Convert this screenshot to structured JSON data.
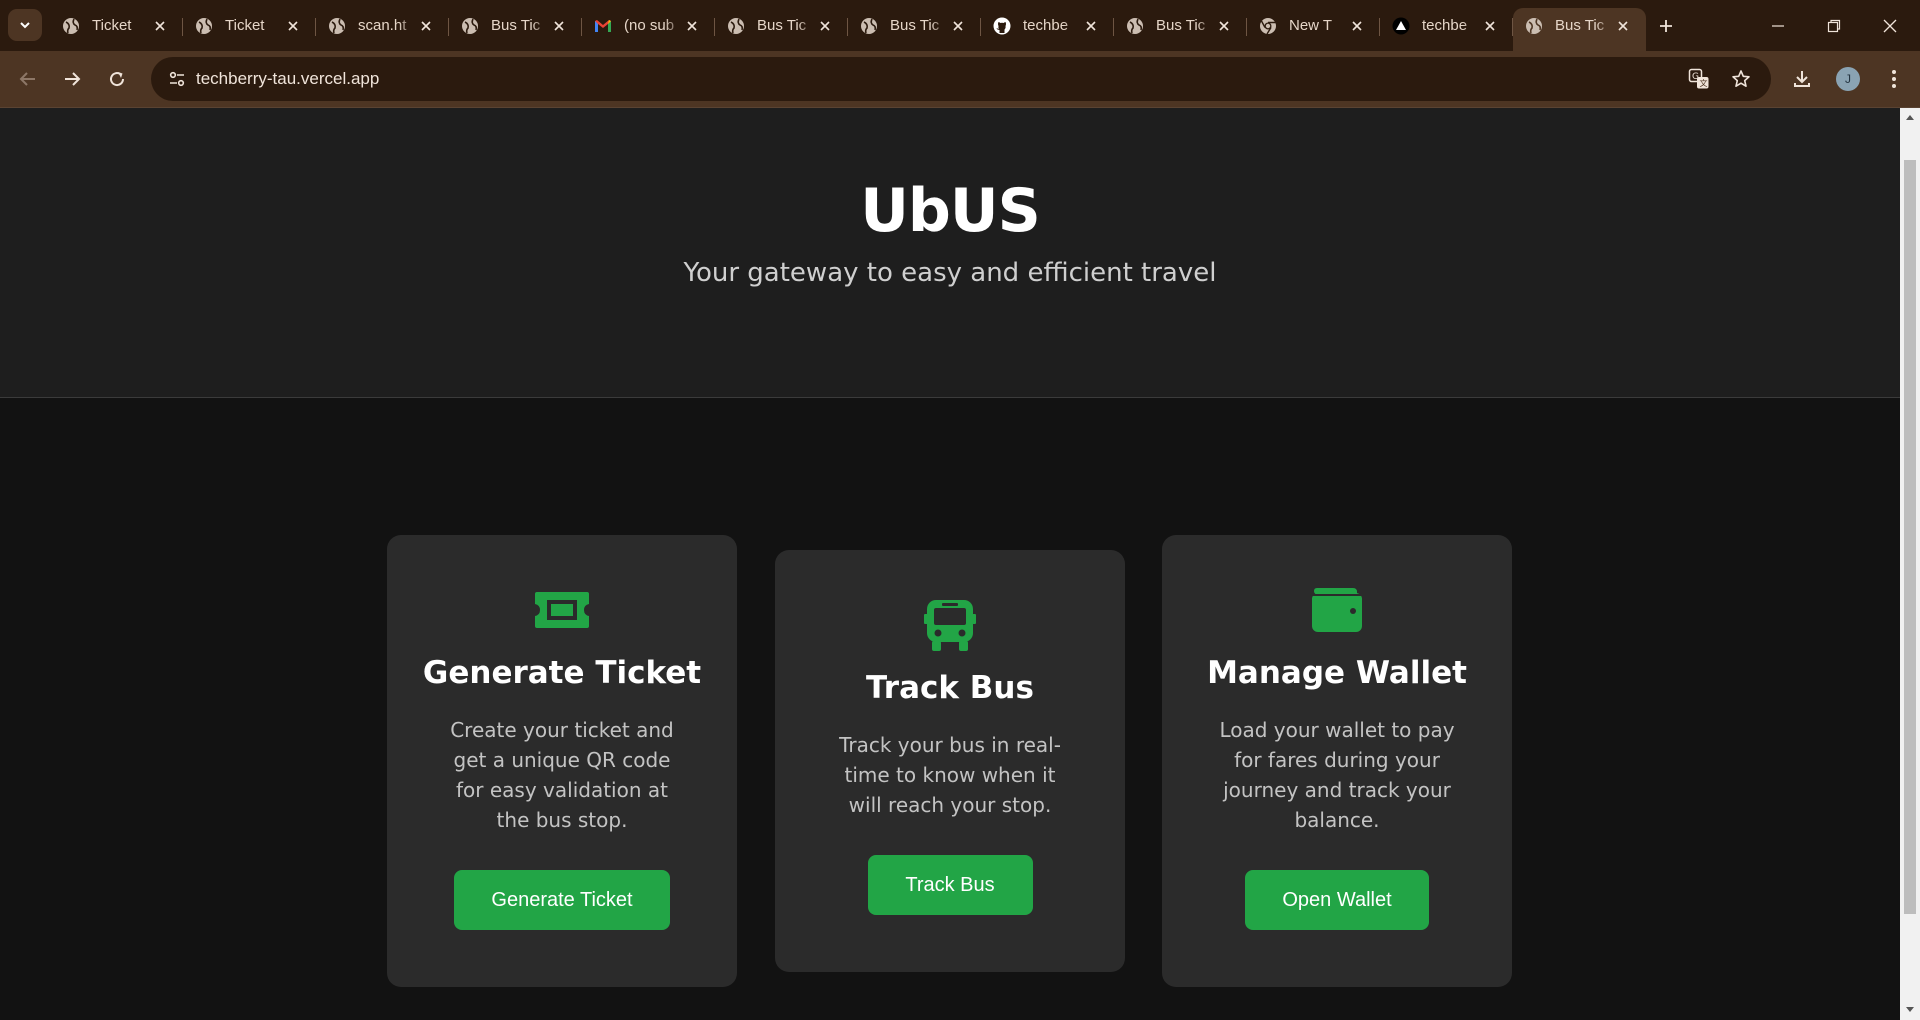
{
  "browser": {
    "tabs": [
      {
        "title": "Ticket",
        "icon": "globe-icon"
      },
      {
        "title": "Ticket",
        "icon": "globe-icon"
      },
      {
        "title": "scan.ht",
        "icon": "globe-icon"
      },
      {
        "title": "Bus Tic",
        "icon": "globe-icon"
      },
      {
        "title": "(no sub",
        "icon": "gmail-icon"
      },
      {
        "title": "Bus Tic",
        "icon": "globe-icon"
      },
      {
        "title": "Bus Tic",
        "icon": "globe-icon"
      },
      {
        "title": "techbe",
        "icon": "github-icon"
      },
      {
        "title": "Bus Tic",
        "icon": "globe-icon"
      },
      {
        "title": "New T",
        "icon": "chrome-icon"
      },
      {
        "title": "techbe",
        "icon": "vercel-icon"
      },
      {
        "title": "Bus Tic",
        "icon": "globe-icon",
        "active": true
      }
    ],
    "url": "techberry-tau.vercel.app",
    "profile_initial": "J",
    "accent": "#4d3523",
    "frame": "#2b1a0e"
  },
  "hero": {
    "title": "UbUS",
    "subtitle": "Your gateway to easy and efficient travel"
  },
  "cards": [
    {
      "icon": "ticket-icon",
      "title": "Generate Ticket",
      "description": "Create your ticket and get a unique QR code for easy validation at the bus stop.",
      "button": "Generate Ticket"
    },
    {
      "icon": "bus-icon",
      "title": "Track Bus",
      "description": "Track your bus in real-time to know when it will reach your stop.",
      "button": "Track Bus"
    },
    {
      "icon": "wallet-icon",
      "title": "Manage Wallet",
      "description": "Load your wallet to pay for fares during your journey and track your balance.",
      "button": "Open Wallet"
    }
  ],
  "colors": {
    "brand_green": "#22a546",
    "card_bg": "#2b2b2b",
    "page_bg": "#121212"
  }
}
